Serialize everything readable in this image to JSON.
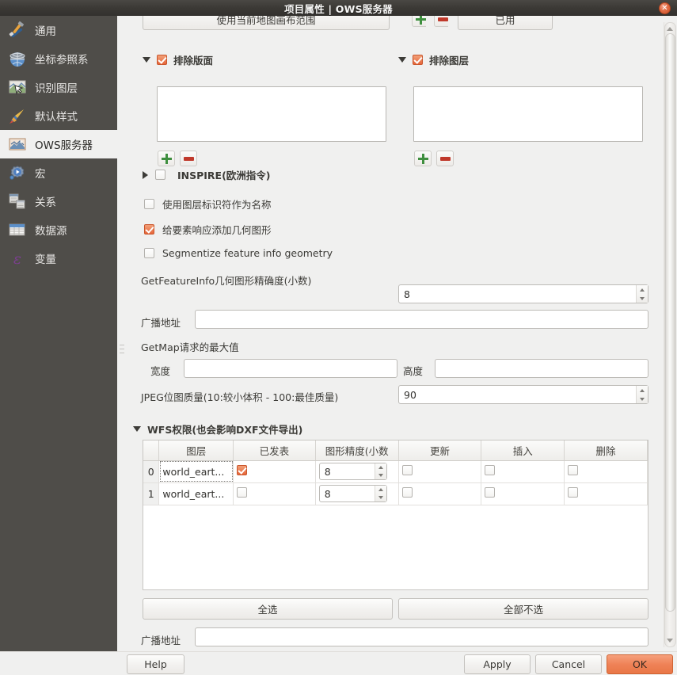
{
  "window": {
    "title": "项目属性 | OWS服务器",
    "close_icon": "close-icon"
  },
  "sidebar": {
    "items": [
      {
        "label": "通用",
        "icon": "tools-icon",
        "selected": false
      },
      {
        "label": "坐标参照系",
        "icon": "globe-icon",
        "selected": false
      },
      {
        "label": "识别图层",
        "icon": "identify-layers-icon",
        "selected": false
      },
      {
        "label": "默认样式",
        "icon": "brush-icon",
        "selected": false
      },
      {
        "label": "OWS服务器",
        "icon": "ows-server-icon",
        "selected": true
      },
      {
        "label": "宏",
        "icon": "macro-icon",
        "selected": false
      },
      {
        "label": "关系",
        "icon": "relations-icon",
        "selected": false
      },
      {
        "label": "数据源",
        "icon": "data-sources-icon",
        "selected": false
      },
      {
        "label": "变量",
        "icon": "variables-icon",
        "selected": false
      }
    ]
  },
  "main": {
    "partial_top": {
      "use_canvas_extent_label": "使用当前地图画布范围",
      "used_label": "已用"
    },
    "exclude_composers": {
      "title": "排除版面",
      "checked": true,
      "collapsed": false,
      "items": [],
      "add_label": "add-icon",
      "remove_label": "remove-icon"
    },
    "exclude_layers": {
      "title": "排除图层",
      "checked": true,
      "collapsed": false,
      "items": [],
      "add_label": "add-icon",
      "remove_label": "remove-icon"
    },
    "inspire": {
      "title": "INSPIRE(欧洲指令)",
      "checked": false,
      "collapsed": true
    },
    "checkboxes": [
      {
        "label": "使用图层标识符作为名称",
        "checked": false
      },
      {
        "label": "给要素响应添加几何图形",
        "checked": true
      },
      {
        "label": "Segmentize feature info geometry",
        "checked": false
      }
    ],
    "getfeatureinfo_precision": {
      "label": "GetFeatureInfo几何图形精确度(小数)",
      "value": "8"
    },
    "advertised_url_top": {
      "label": "广播地址",
      "value": "",
      "placeholder": ""
    },
    "getmap_max": {
      "group_label": "GetMap请求的最大值",
      "width_label": "宽度",
      "width_value": "",
      "height_label": "高度",
      "height_value": ""
    },
    "jpeg_quality": {
      "label": "JPEG位图质量(10:较小体积 - 100:最佳质量)",
      "value": "90"
    },
    "wfs": {
      "title": "WFS权限(也会影响DXF文件导出)",
      "collapsed": false,
      "columns": [
        "",
        "图层",
        "已发表",
        "图形精度(小数",
        "更新",
        "插入",
        "删除"
      ],
      "rows": [
        {
          "index": "0",
          "layer": "world_eart...",
          "published": true,
          "precision": "8",
          "update": false,
          "insert": false,
          "delete": false
        },
        {
          "index": "1",
          "layer": "world_eart...",
          "published": false,
          "precision": "8",
          "update": false,
          "insert": false,
          "delete": false
        }
      ],
      "select_all_label": "全选",
      "deselect_all_label": "全部不选"
    },
    "advertised_url_bottom": {
      "label": "广播地址",
      "value": "",
      "placeholder": ""
    }
  },
  "footer": {
    "help_label": "Help",
    "apply_label": "Apply",
    "cancel_label": "Cancel",
    "ok_label": "OK"
  },
  "colors": {
    "accent": "#e97747",
    "checkbox_on": "#e6663a",
    "titlebar": "#3b3935",
    "sidebar": "#4f4d49",
    "panel_bg": "#f0f0ef"
  }
}
